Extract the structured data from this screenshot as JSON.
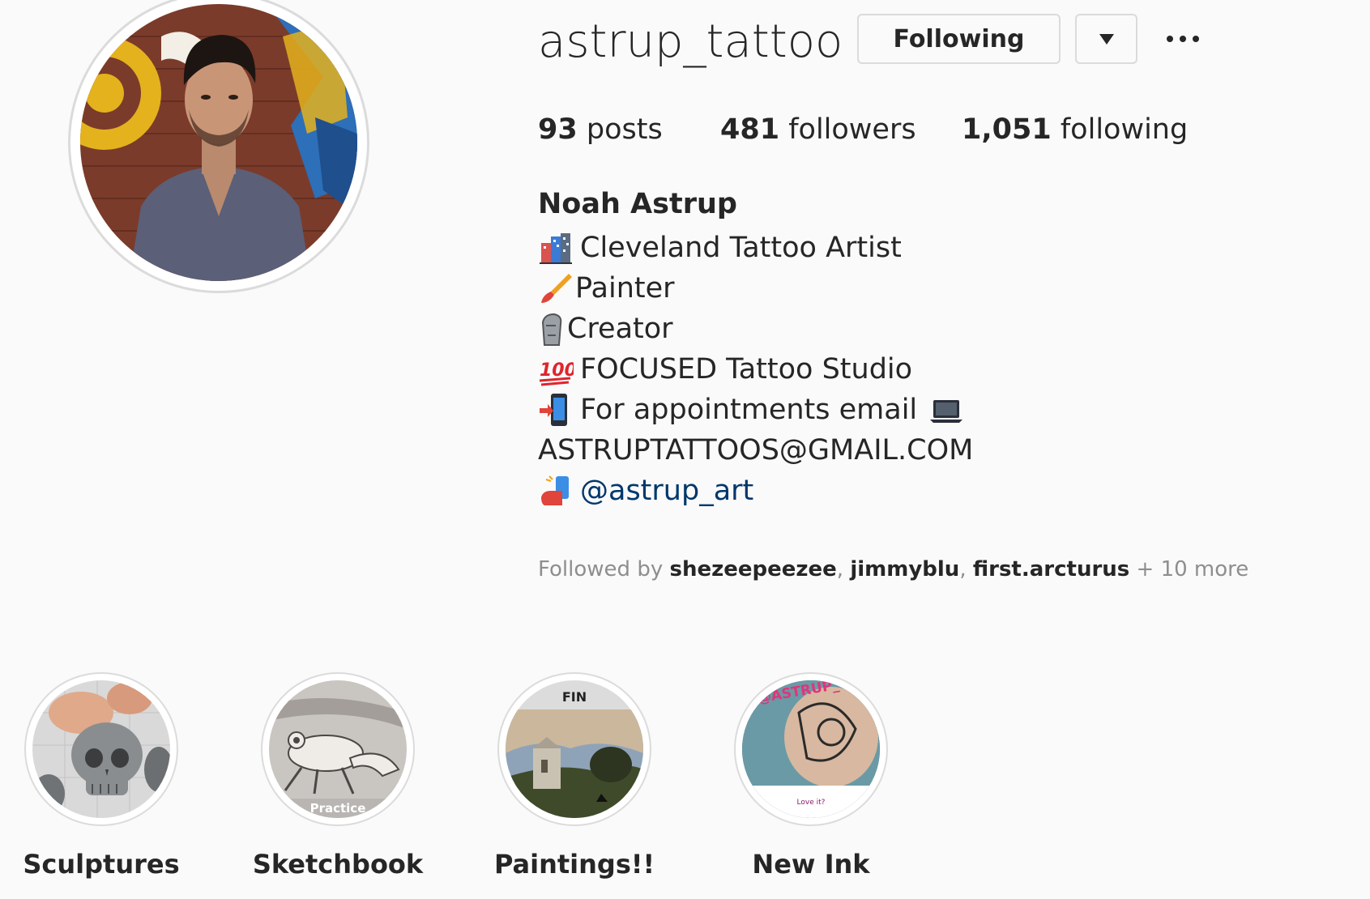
{
  "profile": {
    "username": "astrup_tattoo",
    "following_button": "Following",
    "stats": {
      "posts_count": "93",
      "posts_label": "posts",
      "followers_count": "481",
      "followers_label": "followers",
      "following_count": "1,051",
      "following_label": "following"
    },
    "full_name": "Noah Astrup",
    "bio": {
      "line1": "Cleveland Tattoo Artist",
      "line2": "Painter",
      "line3": "Creator",
      "line4": "FOCUSED Tattoo Studio",
      "line5": "For appointments email",
      "line6": "ASTRUPTATTOOS@GMAIL.COM",
      "link": "@astrup_art"
    },
    "bio_icons": [
      "cityscape-emoji-icon",
      "paintbrush-emoji-icon",
      "moai-emoji-icon",
      "hundred-points-emoji-icon",
      "mobile-phone-arrow-emoji-icon",
      "laptop-emoji-icon",
      "selfie-emoji-icon"
    ],
    "followed_by": {
      "prefix": "Followed by",
      "names": [
        "shezeepeezee",
        "jimmyblu",
        "first.arcturus"
      ],
      "suffix": "+ 10 more"
    }
  },
  "highlights": [
    {
      "label": "Sculptures"
    },
    {
      "label": "Sketchbook",
      "overlay_text": "Practice"
    },
    {
      "label": "Paintings!!",
      "overlay_text": "FIN"
    },
    {
      "label": "New Ink",
      "overlay_text": "@ASTRUP_TA",
      "caption": "Love it?"
    }
  ],
  "colors": {
    "background": "#fafafa",
    "text": "#262626",
    "secondary_text": "#8e8e8e",
    "link": "#00376b",
    "border": "#dbdbdb"
  }
}
